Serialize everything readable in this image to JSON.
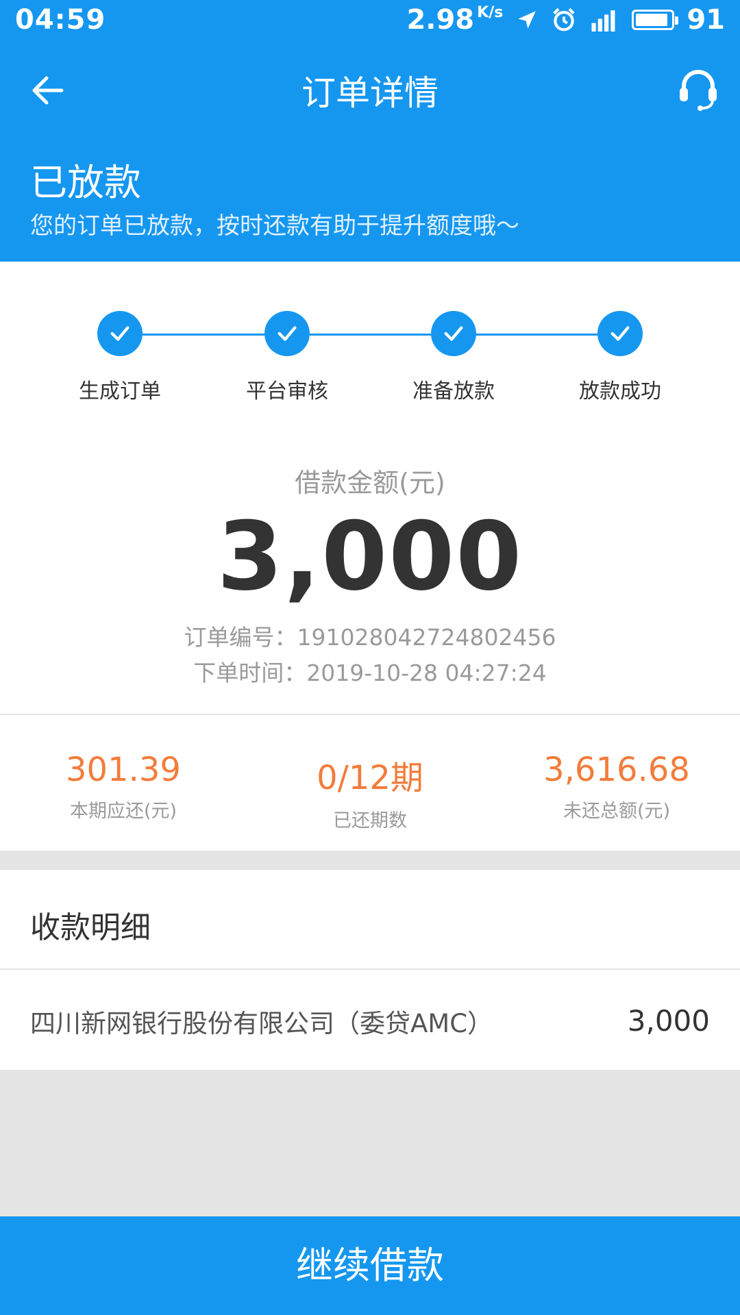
{
  "status_bar": {
    "time": "04:59",
    "speed": "2.98",
    "speed_unit": "K/s",
    "battery": "91",
    "battery_level": 0.91
  },
  "nav": {
    "title": "订单详情"
  },
  "status": {
    "title": "已放款",
    "subtitle": "您的订单已放款，按时还款有助于提升额度哦～"
  },
  "steps": [
    {
      "label": "生成订单",
      "done": true
    },
    {
      "label": "平台审核",
      "done": true
    },
    {
      "label": "准备放款",
      "done": true
    },
    {
      "label": "放款成功",
      "done": true
    }
  ],
  "loan": {
    "amount_label": "借款金额(元)",
    "amount": "3,000",
    "order_no": "订单编号：191028042724802456",
    "order_time": "下单时间：2019-10-28 04:27:24"
  },
  "stats": [
    {
      "value": "301.39",
      "label": "本期应还(元)"
    },
    {
      "value": "0/12期",
      "label": "已还期数"
    },
    {
      "value": "3,616.68",
      "label": "未还总额(元)"
    }
  ],
  "receipt": {
    "title": "收款明细",
    "items": [
      {
        "name": "四川新网银行股份有限公司（委贷AMC）",
        "amount": "3,000"
      }
    ]
  },
  "button": {
    "label": "继续借款"
  },
  "colors": {
    "primary": "#1597f0",
    "accent": "#f27c3b"
  }
}
